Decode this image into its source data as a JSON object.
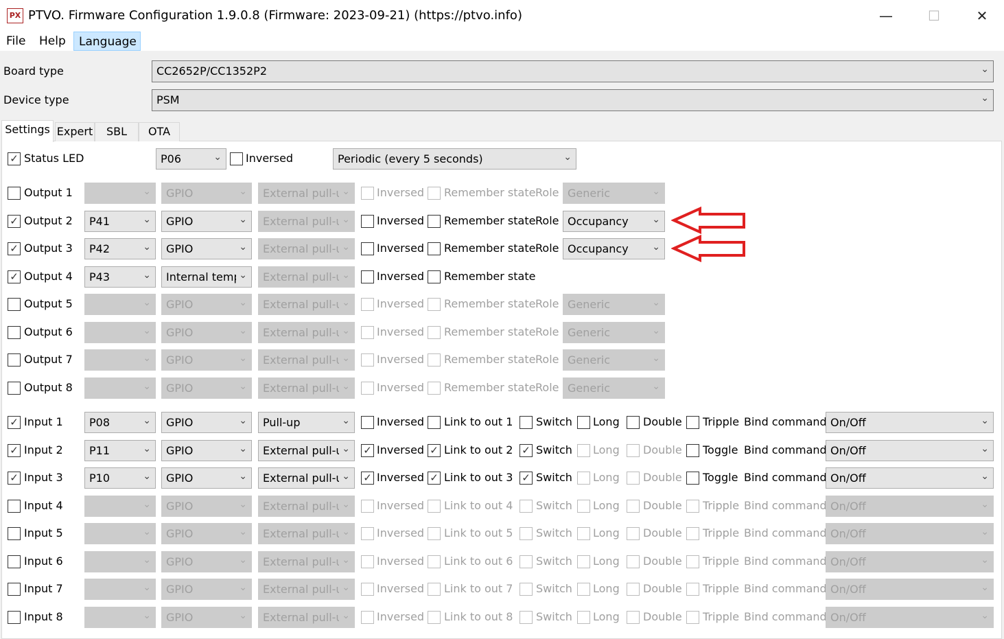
{
  "window": {
    "title": "PTVO. Firmware Configuration 1.9.0.8 (Firmware: 2023-09-21) (https://ptvo.info)",
    "icon_text": "PX",
    "minimize_glyph": "—",
    "maximize_glyph": "☐",
    "close_glyph": "✕"
  },
  "menu": [
    "File",
    "Help",
    "Language"
  ],
  "board": {
    "label": "Board type",
    "value": "CC2652P/CC1352P2"
  },
  "device": {
    "label": "Device type",
    "value": "PSM"
  },
  "tabs": [
    "Settings",
    "Expert",
    "SBL",
    "OTA"
  ],
  "status_led": {
    "label": "Status LED",
    "checked": true,
    "pin": "P06",
    "inversed_label": "Inversed",
    "inversed": false,
    "mode": "Periodic (every 5 seconds)"
  },
  "outputs": [
    {
      "label": "Output 1",
      "enabled": false,
      "pin": "",
      "type": "GPIO",
      "pull": "External pull-up",
      "inversed": false,
      "remember": false,
      "role": "Generic",
      "has_role": true
    },
    {
      "label": "Output 2",
      "enabled": true,
      "pin": "P41",
      "type": "GPIO",
      "pull": "External pull-up",
      "inversed": false,
      "remember": false,
      "role": "Occupancy",
      "has_role": true
    },
    {
      "label": "Output 3",
      "enabled": true,
      "pin": "P42",
      "type": "GPIO",
      "pull": "External pull-up",
      "inversed": false,
      "remember": false,
      "role": "Occupancy",
      "has_role": true
    },
    {
      "label": "Output 4",
      "enabled": true,
      "pin": "P43",
      "type": "Internal temperature",
      "pull": "External pull-up",
      "inversed": false,
      "remember": false,
      "role": "",
      "has_role": false
    },
    {
      "label": "Output 5",
      "enabled": false,
      "pin": "",
      "type": "GPIO",
      "pull": "External pull-up",
      "inversed": false,
      "remember": false,
      "role": "Generic",
      "has_role": true
    },
    {
      "label": "Output 6",
      "enabled": false,
      "pin": "",
      "type": "GPIO",
      "pull": "External pull-up",
      "inversed": false,
      "remember": false,
      "role": "Generic",
      "has_role": true
    },
    {
      "label": "Output 7",
      "enabled": false,
      "pin": "",
      "type": "GPIO",
      "pull": "External pull-up",
      "inversed": false,
      "remember": false,
      "role": "Generic",
      "has_role": true
    },
    {
      "label": "Output 8",
      "enabled": false,
      "pin": "",
      "type": "GPIO",
      "pull": "External pull-up",
      "inversed": false,
      "remember": false,
      "role": "Generic",
      "has_role": true
    }
  ],
  "output_labels": {
    "inversed": "Inversed",
    "remember": "Remember state",
    "role": "Role"
  },
  "inputs": [
    {
      "label": "Input 1",
      "enabled": true,
      "pin": "P08",
      "type": "GPIO",
      "pull": "Pull-up",
      "inversed": false,
      "link_label": "Link to out 1",
      "link": false,
      "switch": false,
      "long": false,
      "long_enabled": true,
      "double": false,
      "double_enabled": true,
      "tri_label": "Tripple",
      "tri": false,
      "bind": "On/Off"
    },
    {
      "label": "Input 2",
      "enabled": true,
      "pin": "P11",
      "type": "GPIO",
      "pull": "External pull-up",
      "inversed": true,
      "link_label": "Link to out 2",
      "link": true,
      "switch": true,
      "long": false,
      "long_enabled": false,
      "double": false,
      "double_enabled": false,
      "tri_label": "Toggle",
      "tri": false,
      "bind": "On/Off"
    },
    {
      "label": "Input 3",
      "enabled": true,
      "pin": "P10",
      "type": "GPIO",
      "pull": "External pull-up",
      "inversed": true,
      "link_label": "Link to out 3",
      "link": true,
      "switch": true,
      "long": false,
      "long_enabled": false,
      "double": false,
      "double_enabled": false,
      "tri_label": "Toggle",
      "tri": false,
      "bind": "On/Off"
    },
    {
      "label": "Input 4",
      "enabled": false,
      "pin": "",
      "type": "GPIO",
      "pull": "External pull-up",
      "inversed": false,
      "link_label": "Link to out 4",
      "link": false,
      "switch": false,
      "long": false,
      "long_enabled": true,
      "double": false,
      "double_enabled": true,
      "tri_label": "Tripple",
      "tri": false,
      "bind": "On/Off"
    },
    {
      "label": "Input 5",
      "enabled": false,
      "pin": "",
      "type": "GPIO",
      "pull": "External pull-up",
      "inversed": false,
      "link_label": "Link to out 5",
      "link": false,
      "switch": false,
      "long": false,
      "long_enabled": true,
      "double": false,
      "double_enabled": true,
      "tri_label": "Tripple",
      "tri": false,
      "bind": "On/Off"
    },
    {
      "label": "Input 6",
      "enabled": false,
      "pin": "",
      "type": "GPIO",
      "pull": "External pull-up",
      "inversed": false,
      "link_label": "Link to out 6",
      "link": false,
      "switch": false,
      "long": false,
      "long_enabled": true,
      "double": false,
      "double_enabled": true,
      "tri_label": "Tripple",
      "tri": false,
      "bind": "On/Off"
    },
    {
      "label": "Input 7",
      "enabled": false,
      "pin": "",
      "type": "GPIO",
      "pull": "External pull-up",
      "inversed": false,
      "link_label": "Link to out 7",
      "link": false,
      "switch": false,
      "long": false,
      "long_enabled": true,
      "double": false,
      "double_enabled": true,
      "tri_label": "Tripple",
      "tri": false,
      "bind": "On/Off"
    },
    {
      "label": "Input 8",
      "enabled": false,
      "pin": "",
      "type": "GPIO",
      "pull": "External pull-up",
      "inversed": false,
      "link_label": "Link to out 8",
      "link": false,
      "switch": false,
      "long": false,
      "long_enabled": true,
      "double": false,
      "double_enabled": true,
      "tri_label": "Tripple",
      "tri": false,
      "bind": "On/Off"
    }
  ],
  "input_labels": {
    "inversed": "Inversed",
    "switch": "Switch",
    "long": "Long",
    "double": "Double",
    "bind": "Bind command"
  },
  "annotations": {
    "arrow_color": "#e02020"
  },
  "icons": {
    "dropdown": "chevron-down-icon",
    "check": "check-icon",
    "arrow": "left-arrow-annotation-icon"
  }
}
